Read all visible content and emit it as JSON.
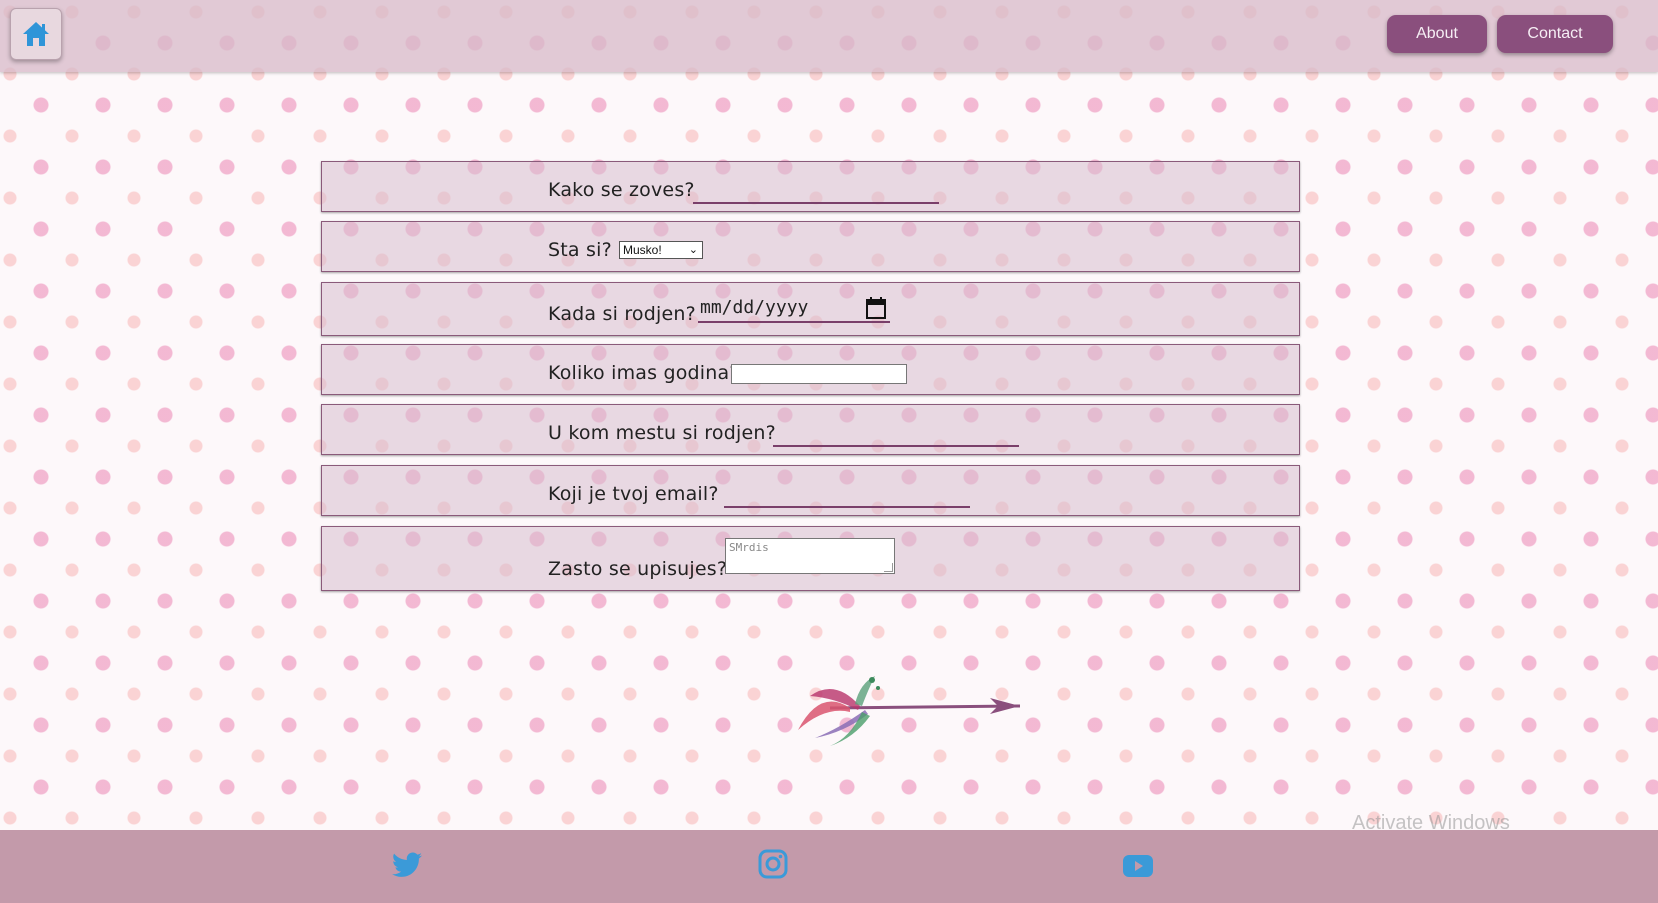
{
  "header": {
    "home_icon": "home-icon",
    "nav": [
      {
        "label": "About"
      },
      {
        "label": "Contact"
      }
    ]
  },
  "form": {
    "name_label": "Kako se zoves?",
    "gender_label": "Sta si?",
    "gender_selected": "Musko!",
    "birthdate_label": "Kada si rodjen?",
    "birthdate_placeholder": "mm/dd/yyyy",
    "age_label": "Koliko imas godina?",
    "birthplace_label": "U kom mestu si rodjen?",
    "email_label": "Koji je tvoj email?",
    "reason_label": "Zasto se upisujes?",
    "reason_placeholder": "SMrdis"
  },
  "watermark": "Activate Windows",
  "footer": {
    "icons": [
      "twitter-icon",
      "instagram-icon",
      "youtube-icon"
    ]
  },
  "colors": {
    "nav_button": "#8a4f7d",
    "header_bg": "#d7b9c8",
    "footer_bg": "#c39aaa",
    "icon_blue": "#3b9ad8"
  }
}
